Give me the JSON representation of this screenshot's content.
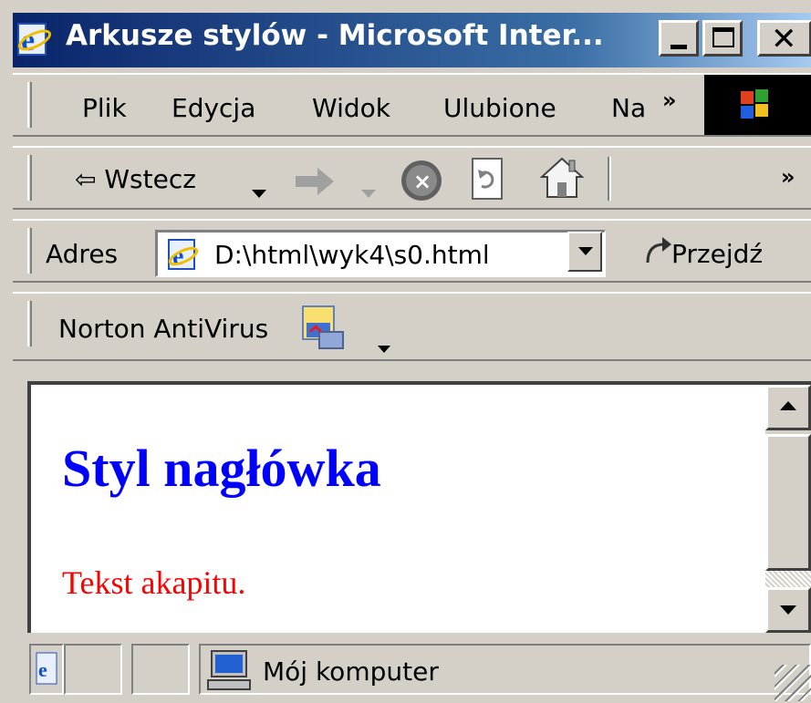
{
  "window": {
    "title": "Arkusze stylów - Microsoft Inter...",
    "min_icon": "minimize-icon",
    "max_icon": "maximize-icon",
    "close_icon": "close-icon"
  },
  "menu": {
    "items": [
      "Plik",
      "Edycja",
      "Widok",
      "Ulubione",
      "Na"
    ],
    "more": "»"
  },
  "toolbar": {
    "back_label": "Wstecz",
    "more": "»"
  },
  "address": {
    "label": "Adres",
    "value": "D:\\html\\wyk4\\s0.html",
    "go_label": "Przejdź"
  },
  "norton": {
    "label": "Norton AntiVirus"
  },
  "content": {
    "heading": "Styl nagłówka",
    "paragraph": "Tekst akapitu."
  },
  "status": {
    "zone": "Mój komputer"
  },
  "colors": {
    "title_start": "#0a246a",
    "title_end": "#a6caf0",
    "heading": "#0000ff",
    "paragraph": "#ff0000",
    "chrome": "#d4d0c8"
  }
}
